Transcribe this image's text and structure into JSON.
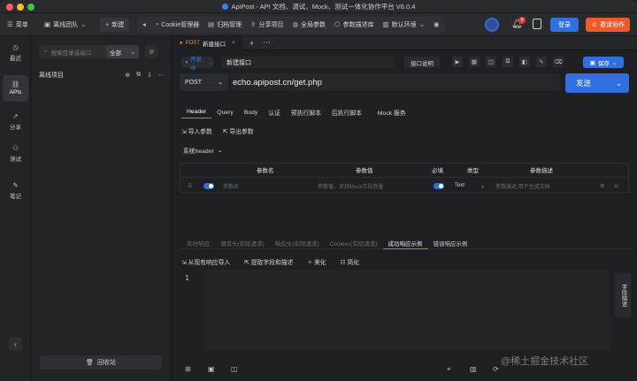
{
  "window": {
    "title": "ApiPost - API 文档、调试、Mock、测试一体化协作平台 V6.0.4"
  },
  "toolbar": {
    "menu_label": "菜单",
    "team_label": "离线团队",
    "new_label": "新建",
    "cookie_label": "Cookie管理器",
    "archive_label": "归档管理",
    "share_label": "分享项目",
    "global_params_label": "全局参数",
    "param_desc_label": "参数描述库",
    "env_label": "默认环境",
    "notif_count": "9",
    "login_label": "登录",
    "invite_label": "邀请协作"
  },
  "rail": {
    "items": [
      {
        "label": "最近"
      },
      {
        "label": "APIs"
      },
      {
        "label": "分享"
      },
      {
        "label": "测试"
      },
      {
        "label": "笔记"
      }
    ]
  },
  "panel": {
    "search_placeholder": "搜索目录或接口",
    "scope_label": "全部",
    "project_name": "离线项目",
    "recycle_label": "回收站"
  },
  "tabs": [
    {
      "method": "POST",
      "label": "新建接口"
    }
  ],
  "request": {
    "env_label": "开发中",
    "name": "新建接口",
    "doc_label": "接口说明",
    "save_label": "保存",
    "method": "POST",
    "url": "echo.apipost.cn/get.php",
    "send_label": "发送",
    "tabs": [
      "Header",
      "Query",
      "Body",
      "认证",
      "预执行脚本",
      "后执行脚本",
      "Mock 服务"
    ],
    "import_label": "导入参数",
    "export_label": "导出参数",
    "sys_header_label": "系统header",
    "table": {
      "headers": [
        "参数名",
        "参数值",
        "必填",
        "类型",
        "参数描述"
      ],
      "row": {
        "name_placeholder": "参数名",
        "value_placeholder": "参数值，支持Mock字段变量",
        "type": "Text",
        "desc_placeholder": "参数描述,用于生成文档"
      }
    }
  },
  "response": {
    "tabs": [
      "实时响应",
      "请求头(实际请求)",
      "响应头(实际请求)",
      "Cookies(实际请求)",
      "成功响应示例",
      "错误响应示例"
    ],
    "active_tab_index": 4,
    "import_label": "从现有响应导入",
    "extract_label": "提取字段和描述",
    "beautify_label": "美化",
    "simplify_label": "简化",
    "line_number": "1",
    "field_tab_label": "字段描述"
  },
  "watermark": "@稀土掘金技术社区",
  "colors": {
    "accent": "#2f6fe0",
    "orange": "#ee5a2a",
    "tab_underline": "#e06c3c"
  }
}
